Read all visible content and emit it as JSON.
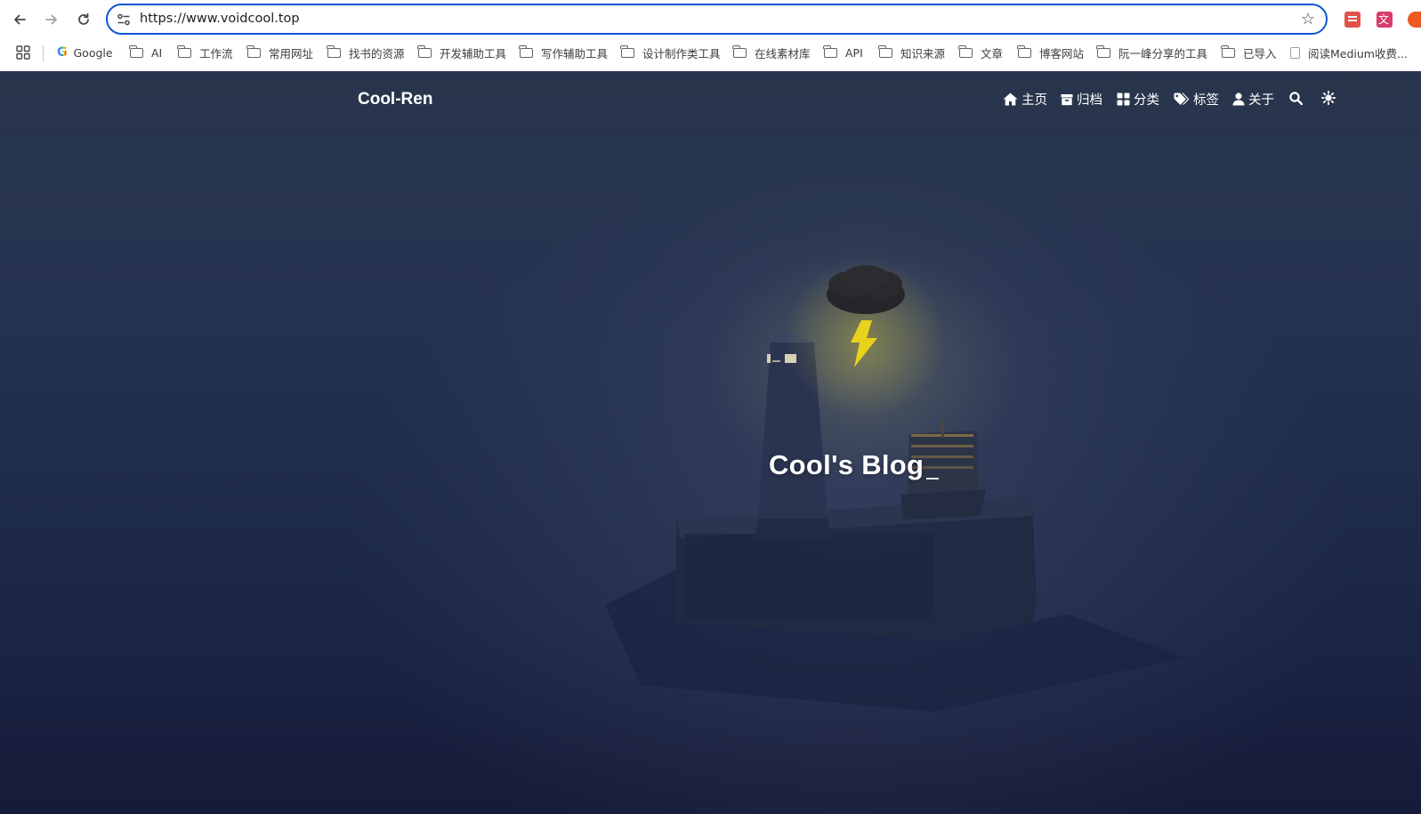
{
  "browser": {
    "url": "https://www.voidcool.top",
    "bookmarks": [
      {
        "label": "Google",
        "icon": "google-icon"
      },
      {
        "label": "AI",
        "icon": "folder-icon"
      },
      {
        "label": "工作流",
        "icon": "folder-icon"
      },
      {
        "label": "常用网址",
        "icon": "folder-icon"
      },
      {
        "label": "找书的资源",
        "icon": "folder-icon"
      },
      {
        "label": "开发辅助工具",
        "icon": "folder-icon"
      },
      {
        "label": "写作辅助工具",
        "icon": "folder-icon"
      },
      {
        "label": "设计制作类工具",
        "icon": "folder-icon"
      },
      {
        "label": "在线素材库",
        "icon": "folder-icon"
      },
      {
        "label": "API",
        "icon": "folder-icon"
      },
      {
        "label": "知识来源",
        "icon": "folder-icon"
      },
      {
        "label": "文章",
        "icon": "folder-icon"
      },
      {
        "label": "博客网站",
        "icon": "folder-icon"
      },
      {
        "label": "阮一峰分享的工具",
        "icon": "folder-icon"
      },
      {
        "label": "已导入",
        "icon": "folder-icon"
      },
      {
        "label": "阅读Medium收费...",
        "icon": "page-icon"
      }
    ]
  },
  "site": {
    "brand": "Cool-Ren",
    "menu": [
      {
        "label": "主页",
        "icon": "home-icon"
      },
      {
        "label": "归档",
        "icon": "archive-icon"
      },
      {
        "label": "分类",
        "icon": "categories-icon"
      },
      {
        "label": "标签",
        "icon": "tags-icon"
      },
      {
        "label": "关于",
        "icon": "user-icon"
      }
    ],
    "hero_title": "Cool's Blog"
  },
  "colors": {
    "omnibox_border": "#0b57d0",
    "header_bg": "#28344a",
    "page_bg": "#1c2748",
    "lightning": "#e8d21c"
  }
}
